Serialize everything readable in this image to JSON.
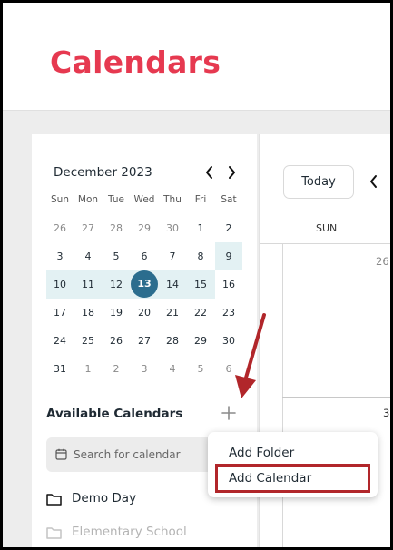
{
  "header": {
    "title": "Calendars"
  },
  "mini_calendar": {
    "month_label": "December 2023",
    "prev_icon": "chevron-left-icon",
    "next_icon": "chevron-right-icon",
    "weekdays": [
      "Sun",
      "Mon",
      "Tue",
      "Wed",
      "Thu",
      "Fri",
      "Sat"
    ],
    "weeks": [
      [
        "26",
        "27",
        "28",
        "29",
        "30",
        "1",
        "2"
      ],
      [
        "3",
        "4",
        "5",
        "6",
        "7",
        "8",
        "9"
      ],
      [
        "10",
        "11",
        "12",
        "13",
        "14",
        "15",
        "16"
      ],
      [
        "17",
        "18",
        "19",
        "20",
        "21",
        "22",
        "23"
      ],
      [
        "24",
        "25",
        "26",
        "27",
        "28",
        "29",
        "30"
      ],
      [
        "31",
        "1",
        "2",
        "3",
        "4",
        "5",
        "6"
      ]
    ],
    "selected_date": "13"
  },
  "sidebar": {
    "available_label": "Available Calendars",
    "add_icon": "plus-icon",
    "search_placeholder": "Search for calendar",
    "calendars": [
      {
        "label": "Demo Day"
      },
      {
        "label": "Elementary School"
      }
    ]
  },
  "main": {
    "today_label": "Today",
    "prev_icon": "chevron-left-icon",
    "day_header": "SUN",
    "dates": [
      "26",
      "3"
    ]
  },
  "menu": {
    "items": [
      {
        "label": "Add Folder"
      },
      {
        "label": "Add Calendar"
      }
    ]
  },
  "colors": {
    "brand": "#e63950",
    "today": "#2b6d8e",
    "highlight_band": "#e3f1f3",
    "annotation": "#b1262a"
  }
}
